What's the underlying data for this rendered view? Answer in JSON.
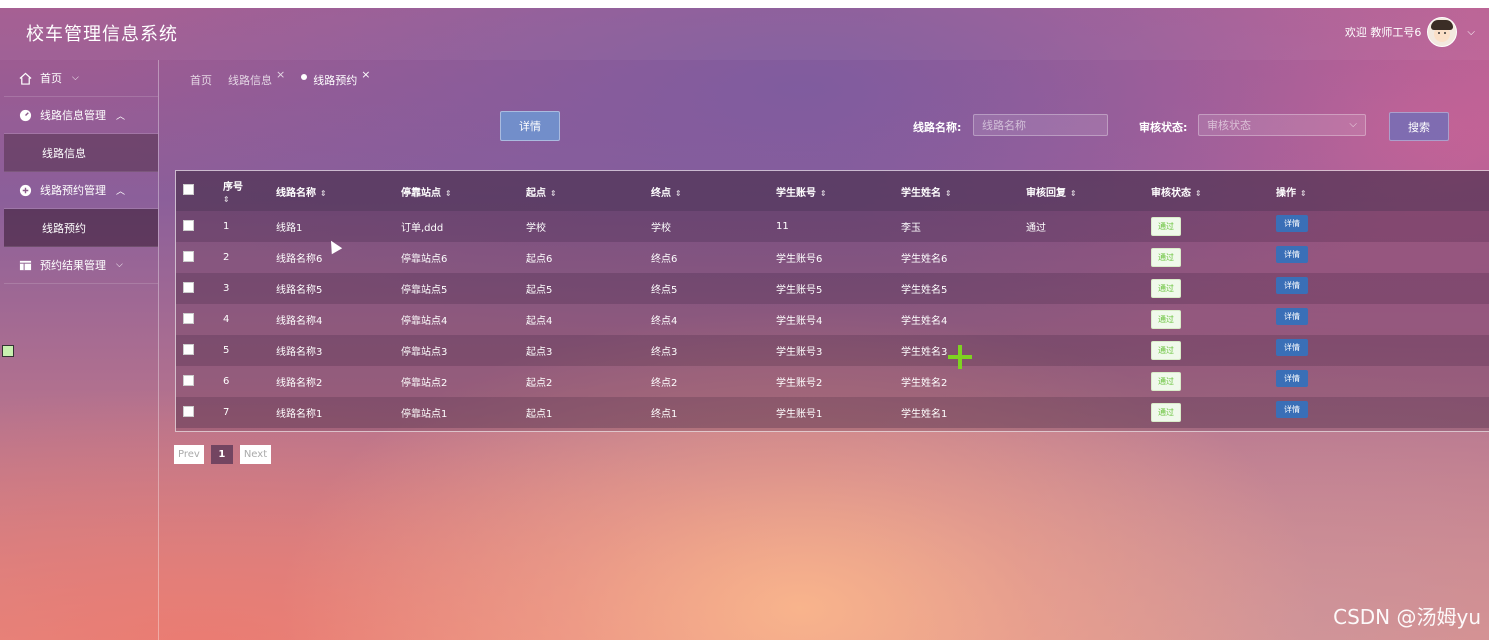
{
  "app": {
    "title": "校车管理信息系统",
    "welcome": "欢迎 教师工号6"
  },
  "sidebar": {
    "items": [
      {
        "label": "首页",
        "icon": "home-icon"
      },
      {
        "label": "线路信息管理",
        "icon": "dashboard-icon"
      },
      {
        "label": "线路信息",
        "icon": ""
      },
      {
        "label": "线路预约管理",
        "icon": "plus-circle-icon"
      },
      {
        "label": "线路预约",
        "icon": ""
      },
      {
        "label": "预约结果管理",
        "icon": "table-icon"
      }
    ]
  },
  "tabs": [
    {
      "label": "首页"
    },
    {
      "label": "线路信息"
    },
    {
      "label": "线路预约"
    }
  ],
  "toolbar": {
    "detail_label": "详情",
    "route_name_label": "线路名称:",
    "route_name_placeholder": "线路名称",
    "status_label": "审核状态:",
    "status_placeholder": "审核状态",
    "search_label": "搜索"
  },
  "table": {
    "headers": [
      "序号",
      "线路名称",
      "停靠站点",
      "起点",
      "终点",
      "学生账号",
      "学生姓名",
      "审核回复",
      "审核状态",
      "操作"
    ],
    "rows": [
      {
        "seq": "1",
        "name": "线路1",
        "stops": "订单,ddd",
        "start": "学校",
        "end": "学校",
        "account": "11",
        "student": "李玉",
        "reply": "通过",
        "status": "通过",
        "action": "详情"
      },
      {
        "seq": "2",
        "name": "线路名称6",
        "stops": "停靠站点6",
        "start": "起点6",
        "end": "终点6",
        "account": "学生账号6",
        "student": "学生姓名6",
        "reply": "",
        "status": "通过",
        "action": "详情"
      },
      {
        "seq": "3",
        "name": "线路名称5",
        "stops": "停靠站点5",
        "start": "起点5",
        "end": "终点5",
        "account": "学生账号5",
        "student": "学生姓名5",
        "reply": "",
        "status": "通过",
        "action": "详情"
      },
      {
        "seq": "4",
        "name": "线路名称4",
        "stops": "停靠站点4",
        "start": "起点4",
        "end": "终点4",
        "account": "学生账号4",
        "student": "学生姓名4",
        "reply": "",
        "status": "通过",
        "action": "详情"
      },
      {
        "seq": "5",
        "name": "线路名称3",
        "stops": "停靠站点3",
        "start": "起点3",
        "end": "终点3",
        "account": "学生账号3",
        "student": "学生姓名3",
        "reply": "",
        "status": "通过",
        "action": "详情"
      },
      {
        "seq": "6",
        "name": "线路名称2",
        "stops": "停靠站点2",
        "start": "起点2",
        "end": "终点2",
        "account": "学生账号2",
        "student": "学生姓名2",
        "reply": "",
        "status": "通过",
        "action": "详情"
      },
      {
        "seq": "7",
        "name": "线路名称1",
        "stops": "停靠站点1",
        "start": "起点1",
        "end": "终点1",
        "account": "学生账号1",
        "student": "学生姓名1",
        "reply": "",
        "status": "通过",
        "action": "详情"
      }
    ]
  },
  "pagination": {
    "prev": "Prev",
    "current": "1",
    "next": "Next"
  },
  "watermark": "CSDN @汤姆yu",
  "colors": {
    "accent": "#3a6fb7",
    "status_ok": "#67c23a"
  }
}
